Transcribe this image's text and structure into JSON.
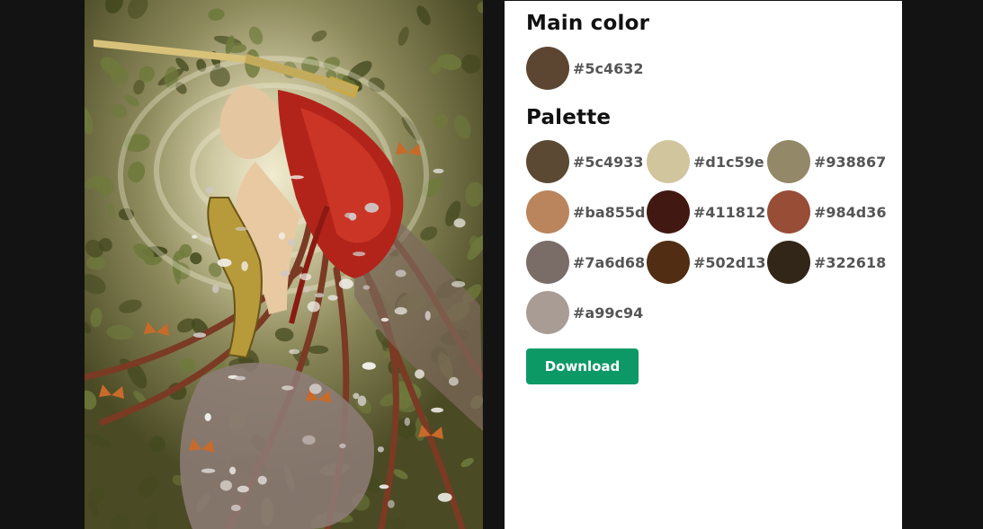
{
  "main_color": {
    "title": "Main color",
    "hex": "#5c4632",
    "color": "#5c4632"
  },
  "palette": {
    "title": "Palette",
    "swatches": [
      {
        "hex": "#5c4933",
        "color": "#5c4933"
      },
      {
        "hex": "#d1c59e",
        "color": "#d1c59e"
      },
      {
        "hex": "#938867",
        "color": "#938867"
      },
      {
        "hex": "#ba855d",
        "color": "#ba855d"
      },
      {
        "hex": "#411812",
        "color": "#411812"
      },
      {
        "hex": "#984d36",
        "color": "#984d36"
      },
      {
        "hex": "#7a6d68",
        "color": "#7a6d68"
      },
      {
        "hex": "#502d13",
        "color": "#502d13"
      },
      {
        "hex": "#322618",
        "color": "#322618"
      },
      {
        "hex": "#a99c94",
        "color": "#a99c94"
      }
    ]
  },
  "actions": {
    "download_label": "Download"
  },
  "artwork": {
    "colors": {
      "glow": "#e9e4c2",
      "foliage": "#6f7a3c",
      "foliage_dark": "#45491f",
      "hair": "#b2241a",
      "roots": "#7a3a24",
      "armor": "#b79a3a",
      "blade": "#d8c27a",
      "petals": "#cfc8c6",
      "butterflies": "#c86a2a"
    }
  },
  "accent": "#0d9966"
}
